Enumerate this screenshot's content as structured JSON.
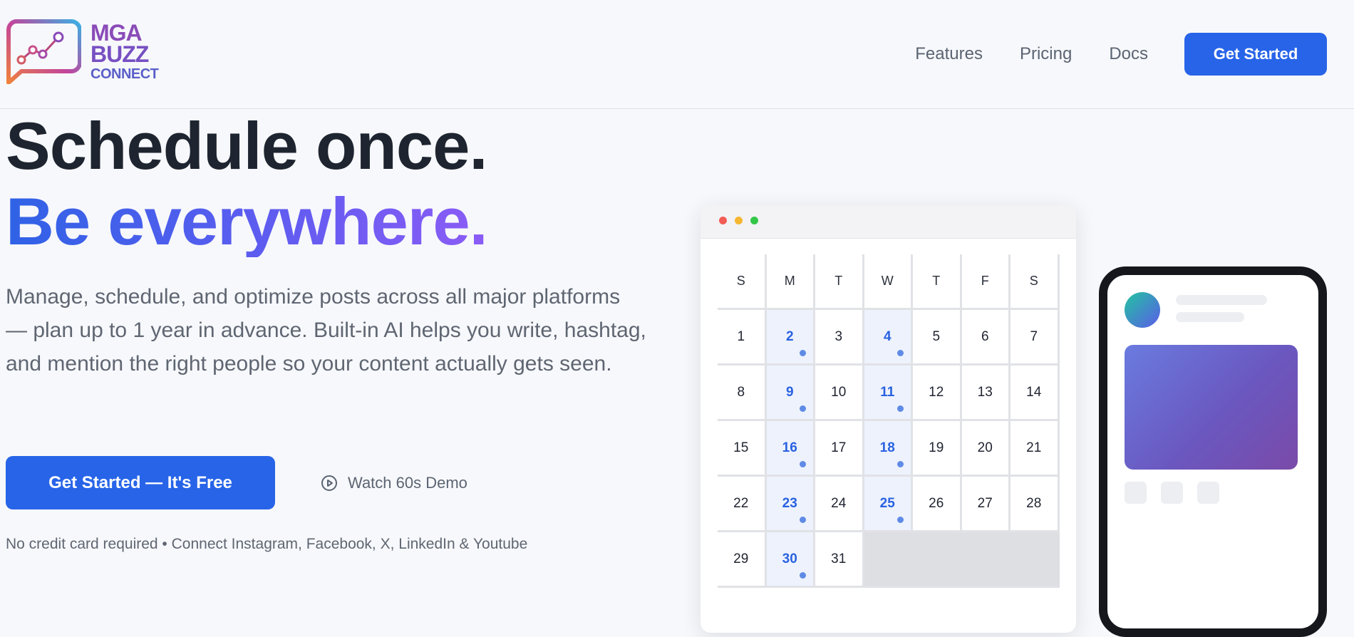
{
  "brand": {
    "logo_line1": "MGA",
    "logo_line2": "BUZZ",
    "logo_line3": "CONNECT",
    "colors": {
      "primary": "#2764e8",
      "gradient_start": "#2f62e6",
      "gradient_end": "#8b5cf6"
    }
  },
  "nav": {
    "links": [
      "Features",
      "Pricing",
      "Docs"
    ],
    "cta": "Get Started"
  },
  "hero": {
    "headline_line1": "Schedule once.",
    "headline_line2": "Be everywhere.",
    "subheadline": "Manage, schedule, and optimize posts across all major platforms — plan up to 1 year in advance. Built-in AI helps you write, hashtag, and mention the right people so your content actually gets seen.",
    "cta_primary": "Get Started — It's Free",
    "cta_secondary": "Watch 60s Demo",
    "cta_secondary_icon": "play-circle-icon",
    "note": "No credit card required • Connect Instagram, Facebook, X, LinkedIn & Youtube"
  },
  "calendar": {
    "weekdays": [
      "S",
      "M",
      "T",
      "W",
      "T",
      "F",
      "S"
    ],
    "days": [
      "1",
      "2",
      "3",
      "4",
      "5",
      "6",
      "7",
      "8",
      "9",
      "10",
      "11",
      "12",
      "13",
      "14",
      "15",
      "16",
      "17",
      "18",
      "19",
      "20",
      "21",
      "22",
      "23",
      "24",
      "25",
      "26",
      "27",
      "28",
      "29",
      "30",
      "31"
    ],
    "highlighted_days": [
      "2",
      "4",
      "9",
      "11",
      "16",
      "18",
      "23",
      "25",
      "30"
    ]
  }
}
